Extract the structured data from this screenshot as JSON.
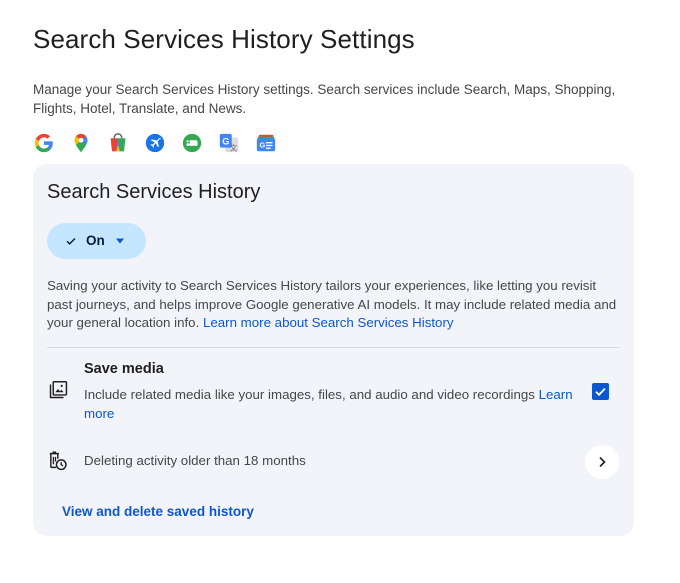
{
  "page": {
    "title": "Search Services History Settings",
    "intro": "Manage your Search Services History settings. Search services include Search, Maps, Shopping, Flights, Hotel, Translate, and News."
  },
  "service_icons": [
    "google-g-icon",
    "maps-pin-icon",
    "shopping-bag-icon",
    "flights-plane-icon",
    "hotel-bed-icon",
    "translate-icon",
    "news-icon"
  ],
  "card": {
    "title": "Search Services History",
    "status_chip": {
      "label": "On",
      "icon": "check-icon",
      "caret_icon": "caret-down-icon"
    },
    "description": "Saving your activity to Search Services History tailors your experiences, like letting you revisit past journeys, and helps improve Google generative AI models. It may include related media and your general location info.",
    "learn_more_link": "Learn more about Search Services History",
    "save_media": {
      "title": "Save media",
      "description": "Include related media like your images, files, and audio and video recordings",
      "learn_more": "Learn more",
      "checked": true,
      "icon": "photo-library-icon"
    },
    "auto_delete": {
      "text": "Deleting activity older than 18 months",
      "icon": "auto-delete-icon"
    },
    "view_history_link": "View and delete saved history"
  },
  "colors": {
    "accent": "#0b57d0",
    "chip_bg": "#c4e7ff",
    "card_bg": "#f3f4fa",
    "text_primary": "#1f1f1f",
    "text_secondary": "#444746"
  }
}
